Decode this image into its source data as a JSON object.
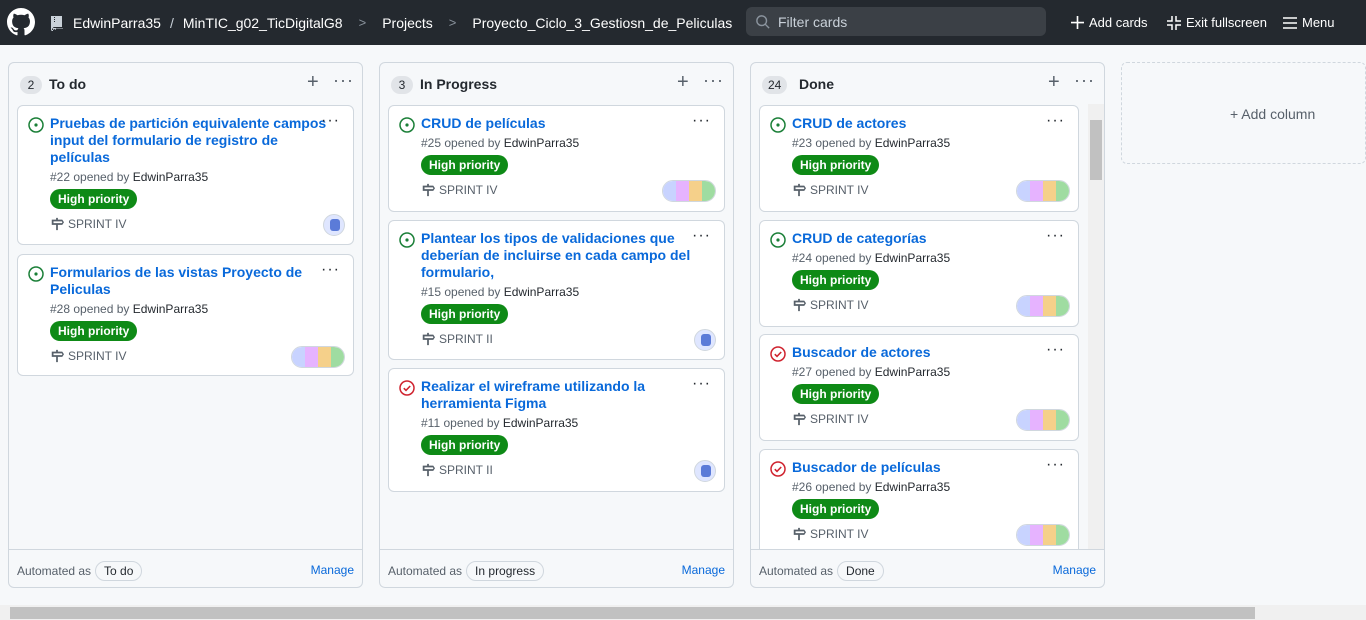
{
  "header": {
    "user": "EdwinParra35",
    "separator": "/",
    "repo": "MinTIC_g02_TicDigitalG8",
    "chev": ">",
    "projects": "Projects",
    "project_name": "Proyecto_Ciclo_3_Gestiosn_de_Peliculas",
    "filter_placeholder": "Filter cards",
    "add_cards": "Add cards",
    "exit_fullscreen": "Exit fullscreen",
    "menu": "Menu"
  },
  "columns": [
    {
      "count": "2",
      "title": "To do",
      "automated_label": "Automated as",
      "automation": "To do",
      "manage": "Manage",
      "cards": [
        {
          "status": "open",
          "title_lines": [
            "Pruebas de partición equivalente campos",
            "input del formulario de registro de",
            "películas"
          ],
          "number": "#22 opened by",
          "author": "EdwinParra35",
          "label": "High priority",
          "milestone": "SPRINT IV"
        },
        {
          "status": "open",
          "title_lines": [
            "Formularios de las vistas Proyecto de",
            "Peliculas"
          ],
          "number": "#28 opened by",
          "author": "EdwinParra35",
          "label": "High priority",
          "milestone": "SPRINT IV"
        }
      ]
    },
    {
      "count": "3",
      "title": "In Progress",
      "automated_label": "Automated as",
      "automation": "In progress",
      "manage": "Manage",
      "cards": [
        {
          "status": "open",
          "title_lines": [
            "CRUD de películas"
          ],
          "number": "#25 opened by",
          "author": "EdwinParra35",
          "label": "High priority",
          "milestone": "SPRINT IV"
        },
        {
          "status": "open",
          "title_lines": [
            "Plantear los tipos de validaciones que",
            "deberían de incluirse en cada campo del",
            "formulario,"
          ],
          "number": "#15 opened by",
          "author": "EdwinParra35",
          "label": "High priority",
          "milestone": "SPRINT II"
        },
        {
          "status": "closed",
          "title_lines": [
            "Realizar el wireframe utilizando la",
            "herramienta Figma"
          ],
          "number": "#11 opened by",
          "author": "EdwinParra35",
          "label": "High priority",
          "milestone": "SPRINT II"
        }
      ]
    },
    {
      "count": "24",
      "title": "Done",
      "automated_label": "Automated as",
      "automation": "Done",
      "manage": "Manage",
      "cards": [
        {
          "status": "open",
          "title_lines": [
            "CRUD de actores"
          ],
          "number": "#23 opened by",
          "author": "EdwinParra35",
          "label": "High priority",
          "milestone": "SPRINT IV"
        },
        {
          "status": "open",
          "title_lines": [
            "CRUD de categorías"
          ],
          "number": "#24 opened by",
          "author": "EdwinParra35",
          "label": "High priority",
          "milestone": "SPRINT IV"
        },
        {
          "status": "closed",
          "title_lines": [
            "Buscador de actores"
          ],
          "number": "#27 opened by",
          "author": "EdwinParra35",
          "label": "High priority",
          "milestone": "SPRINT IV"
        },
        {
          "status": "closed",
          "title_lines": [
            "Buscador de películas"
          ],
          "number": "#26 opened by",
          "author": "EdwinParra35",
          "label": "High priority",
          "milestone": "SPRINT IV"
        }
      ]
    }
  ],
  "add_column": "+ Add column",
  "colors": {
    "label_green": "#0e8a16",
    "link_blue": "#0969da",
    "open_green": "#1a7f37",
    "closed_red": "#cf222e",
    "topbar": "#24292f"
  },
  "icons": {
    "logo": "github-logo-icon",
    "repo": "repo-icon",
    "search": "search-icon",
    "plus": "plus-icon",
    "fullscreen": "exit-fullscreen-icon",
    "menu": "hamburger-icon",
    "open": "issue-open-icon",
    "closed": "issue-closed-icon",
    "milestone": "milestone-icon"
  }
}
